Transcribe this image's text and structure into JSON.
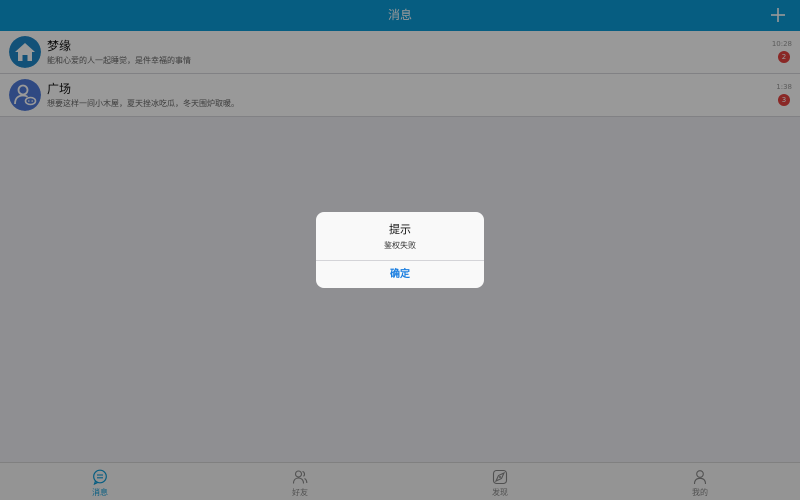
{
  "header": {
    "title": "消息",
    "add_icon": "plus-icon"
  },
  "conversations": [
    {
      "title": "梦缘",
      "preview": "能和心爱的人一起睡觉，是件幸福的事情",
      "time": "10:28",
      "badge": "2",
      "avatar_icon": "home-icon",
      "avatar_color": "#1e88c8"
    },
    {
      "title": "广场",
      "preview": "想要这样一间小木屋，夏天挫冰吃瓜，冬天围炉取暖。",
      "time": "1:38",
      "badge": "3",
      "avatar_icon": "user-chat-icon",
      "avatar_color": "#4f7bd9"
    }
  ],
  "tabs": [
    {
      "label": "消息",
      "icon": "message-icon",
      "active": true
    },
    {
      "label": "好友",
      "icon": "friends-icon",
      "active": false
    },
    {
      "label": "发现",
      "icon": "discover-icon",
      "active": false
    },
    {
      "label": "我的",
      "icon": "profile-icon",
      "active": false
    }
  ],
  "dialog": {
    "title": "提示",
    "message": "鉴权失败",
    "confirm_label": "确定"
  },
  "colors": {
    "accent": "#0a9bd8",
    "badge": "#e64340",
    "dialog_button": "#1a7ee0"
  }
}
